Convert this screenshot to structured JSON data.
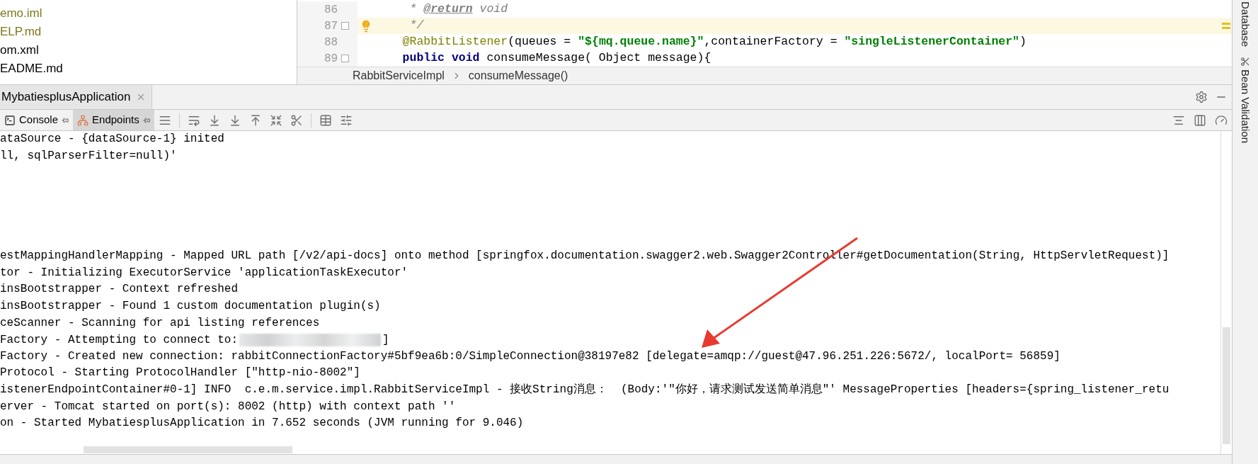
{
  "project_tree": {
    "items": [
      {
        "label": "emo.iml",
        "color": "#7a7a1e"
      },
      {
        "label": "ELP.md",
        "color": "#7a7a1e"
      },
      {
        "label": "om.xml",
        "color": "#000000"
      },
      {
        "label": "EADME.md",
        "color": "#000000"
      }
    ]
  },
  "editor": {
    "lines": [
      {
        "number": "86",
        "current": false,
        "bulb": false,
        "fold": false,
        "tokens": [
          {
            "kind": "comment",
            "text": "     * "
          },
          {
            "kind": "doctag",
            "text": "@return"
          },
          {
            "kind": "comment",
            "text": " void"
          }
        ]
      },
      {
        "number": "87",
        "current": true,
        "bulb": true,
        "fold": true,
        "tokens": [
          {
            "kind": "comment",
            "text": "     */"
          }
        ]
      },
      {
        "number": "88",
        "current": false,
        "bulb": false,
        "fold": false,
        "tokens": [
          {
            "kind": "annotation",
            "text": "    @RabbitListener"
          },
          {
            "kind": "plain",
            "text": "(queues = "
          },
          {
            "kind": "string",
            "text": "\"${mq.queue.name}\""
          },
          {
            "kind": "plain",
            "text": ",containerFactory = "
          },
          {
            "kind": "string",
            "text": "\"singleListenerContainer\""
          },
          {
            "kind": "plain",
            "text": ")"
          }
        ]
      },
      {
        "number": "89",
        "current": false,
        "bulb": false,
        "fold": true,
        "tokens": [
          {
            "kind": "keyword",
            "text": "    public void"
          },
          {
            "kind": "plain",
            "text": " consumeMessage( Object message){"
          }
        ]
      }
    ],
    "breadcrumbs": [
      "RabbitServiceImpl",
      "consumeMessage()"
    ]
  },
  "run_panel": {
    "tabs": [
      {
        "label": "MybatiesplusApplication",
        "selected": true
      }
    ],
    "tool_tabs": [
      {
        "label": "Console",
        "selected": false
      },
      {
        "label": "Endpoints",
        "selected": true
      }
    ],
    "console_lines": [
      {
        "kind": "text",
        "text": "ataSource - {dataSource-1} inited"
      },
      {
        "kind": "text",
        "text": "ll, sqlParserFilter=null)'"
      },
      {
        "kind": "blank"
      },
      {
        "kind": "blank"
      },
      {
        "kind": "blank"
      },
      {
        "kind": "blank"
      },
      {
        "kind": "blank"
      },
      {
        "kind": "text",
        "text": "estMappingHandlerMapping - Mapped URL path [/v2/api-docs] onto method [springfox.documentation.swagger2.web.Swagger2Controller#getDocumentation(String, HttpServletRequest)]"
      },
      {
        "kind": "text",
        "text": "tor - Initializing ExecutorService 'applicationTaskExecutor'"
      },
      {
        "kind": "text",
        "text": "insBootstrapper - Context refreshed"
      },
      {
        "kind": "text",
        "text": "insBootstrapper - Found 1 custom documentation plugin(s)"
      },
      {
        "kind": "text",
        "text": "ceScanner - Scanning for api listing references"
      },
      {
        "kind": "redacted",
        "text": "Factory - Attempting to connect to:",
        "tail": "]"
      },
      {
        "kind": "text",
        "text": "Factory - Created new connection: rabbitConnectionFactory#5bf9ea6b:0/SimpleConnection@38197e82 [delegate=amqp://guest@47.96.251.226:5672/, localPort= 56859]"
      },
      {
        "kind": "text",
        "text": "Protocol - Starting ProtocolHandler [\"http-nio-8002\"]"
      },
      {
        "kind": "text",
        "text": "istenerEndpointContainer#0-1] INFO  c.e.m.service.impl.RabbitServiceImpl - 接收String消息：  (Body:'\"你好，请求测试发送简单消息\"' MessageProperties [headers={spring_listener_retu"
      },
      {
        "kind": "text",
        "text": "erver - Tomcat started on port(s): 8002 (http) with context path ''"
      },
      {
        "kind": "text",
        "text": "on - Started MybatiesplusApplication in 7.652 seconds (JVM running for 9.046)"
      }
    ]
  },
  "side_strip": {
    "items": [
      {
        "label": "Database",
        "kind": "plain"
      },
      {
        "label": "Bean Validation",
        "kind": "icon"
      }
    ]
  }
}
